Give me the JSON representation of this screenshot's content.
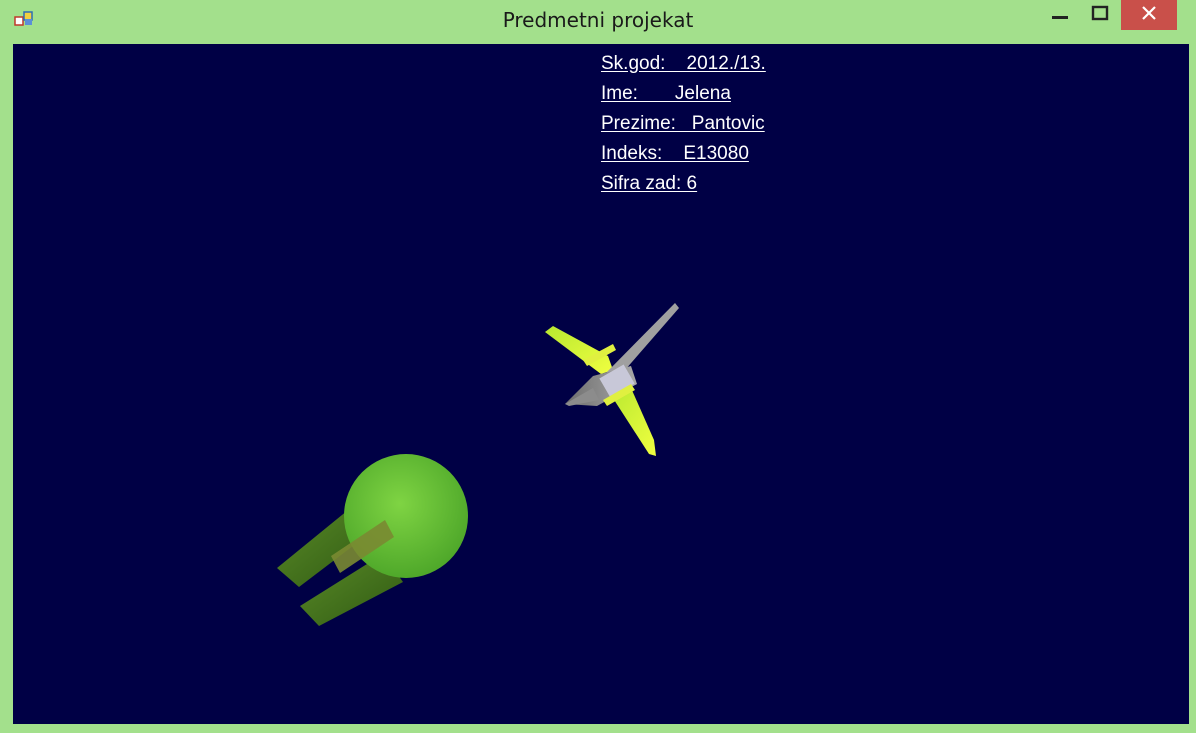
{
  "window": {
    "title": "Predmetni projekat",
    "controls": {
      "minimize": "minimize-icon",
      "maximize": "maximize-icon",
      "close": "close-icon"
    }
  },
  "info": {
    "school_year": "Sk.god:    2012./13.",
    "first_name": "Ime:       Jelena",
    "last_name": "Prezime:   Pantovic",
    "index": "Indeks:    E13080",
    "task": "Sifra zad: 6"
  },
  "colors": {
    "frame": "#a3e08c",
    "background": "#000045",
    "close_button": "#c9504a",
    "text": "#ffffff",
    "planet": "#6cc23a",
    "ship_hull": "#8a8a8a",
    "ship_wings": "#d8f03a"
  }
}
